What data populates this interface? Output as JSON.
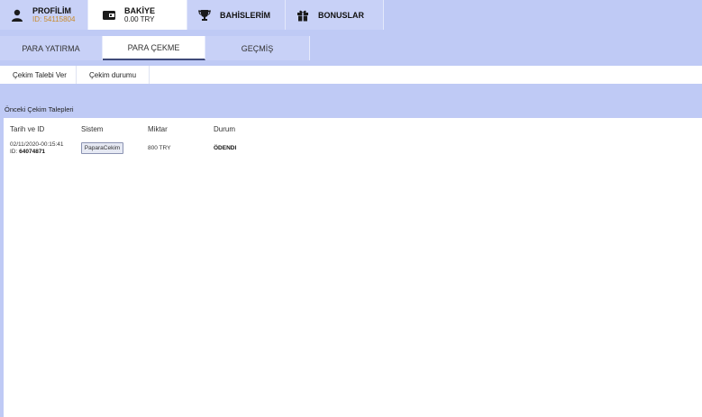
{
  "top_tabs": {
    "profile": {
      "title": "PROFİLİM",
      "subtitle": "ID: 54115804",
      "icon": "user-icon"
    },
    "balance": {
      "title": "BAKİYE",
      "subtitle": "0.00 TRY",
      "icon": "wallet-icon"
    },
    "bets": {
      "title": "BAHİSLERİM",
      "icon": "trophy-icon"
    },
    "bonus": {
      "title": "BONUSLAR",
      "icon": "gift-icon"
    }
  },
  "main_tabs": [
    {
      "label": "PARA YATIRMA"
    },
    {
      "label": "PARA ÇEKME"
    },
    {
      "label": "GEÇMİŞ"
    }
  ],
  "sub_tabs": [
    {
      "label": "Çekim Talebi Ver"
    },
    {
      "label": "Çekim durumu"
    }
  ],
  "section": {
    "title": "Önceki Çekim Talepleri",
    "columns": [
      "Tarih ve ID",
      "Sistem",
      "Miktar",
      "Durum"
    ],
    "rows": [
      {
        "date": "02/11/2020-00:15:41",
        "id_label": "ID:",
        "id": "64074871",
        "system": "PaparaCekim",
        "amount": "800 TRY",
        "status": "ÖDENDI"
      }
    ]
  }
}
